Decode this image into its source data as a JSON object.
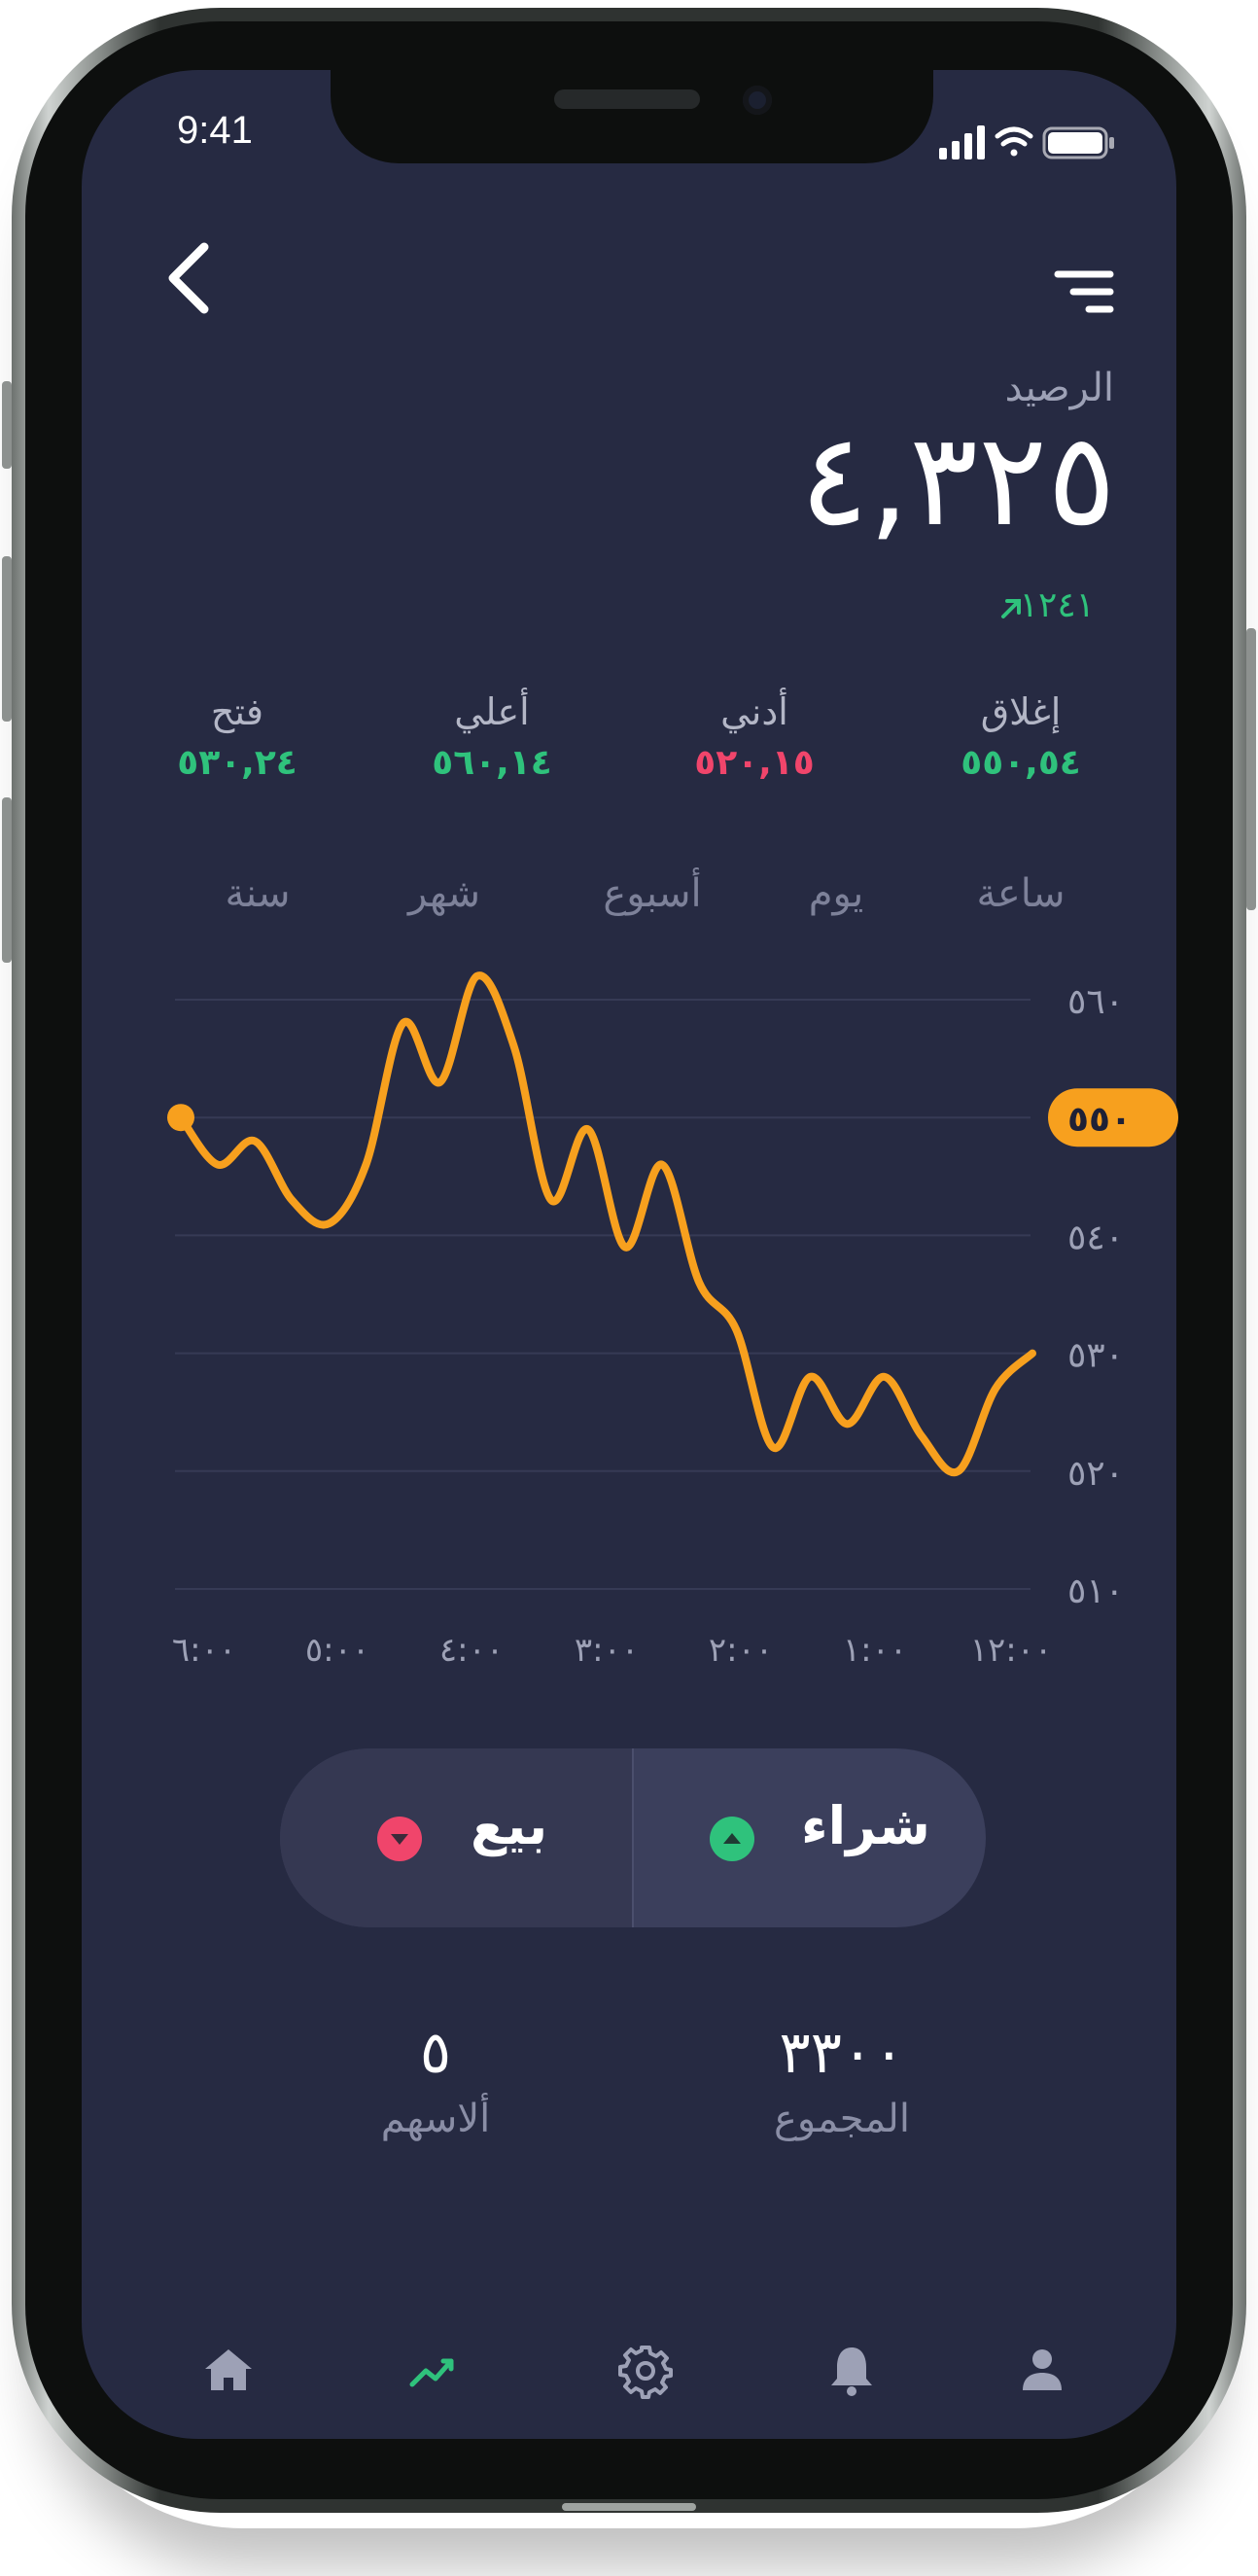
{
  "status": {
    "time": "9:41"
  },
  "header": {
    "back_icon": "chevron-left-icon",
    "menu_icon": "sort-menu-icon"
  },
  "balance": {
    "label": "الرصيد",
    "value": "٤,٣٢٥",
    "change": "١٢٤١",
    "change_icon": "arrow-up-right-icon",
    "change_color": "#2fc27c"
  },
  "stats": [
    {
      "label": "فتح",
      "value": "٥٣٠,٢٤",
      "color": "#2fc27c"
    },
    {
      "label": "أعلي",
      "value": "٥٦٠,١٤",
      "color": "#2fc27c"
    },
    {
      "label": "أدني",
      "value": "٥٢٠,١٥",
      "color": "#f0456b"
    },
    {
      "label": "إغلاق",
      "value": "٥٥٠,٥٤",
      "color": "#2fc27c"
    }
  ],
  "tabs": [
    {
      "label": "سنة"
    },
    {
      "label": "شهر"
    },
    {
      "label": "أسبوع"
    },
    {
      "label": "يوم"
    },
    {
      "label": "ساعة",
      "active": true
    }
  ],
  "chart_data": {
    "type": "line",
    "series": [
      {
        "color": "#f7a01e",
        "values": [
          550,
          546,
          548,
          543,
          541,
          546,
          558,
          553,
          562,
          556,
          543,
          549,
          539,
          546,
          536,
          532,
          522,
          528,
          524,
          528,
          523,
          520,
          527,
          530
        ]
      }
    ],
    "x_tick_labels": [
      "٦:٠٠",
      "٥:٠٠",
      "٤:٠٠",
      "٣:٠٠",
      "٢:٠٠",
      "١:٠٠",
      "١٢:٠٠"
    ],
    "y_tick_labels": [
      "٥٦٠",
      "٥٥٠",
      "٥٤٠",
      "٥٣٠",
      "٥٢٠",
      "٥١٠"
    ],
    "y_ticks": [
      560,
      550,
      540,
      530,
      520,
      510
    ],
    "ylim": [
      510,
      560
    ],
    "highlight": {
      "value": 550,
      "label": "٥٥٠",
      "color": "#f7a01e"
    },
    "grid": true
  },
  "trade": {
    "buy_label": "شراء",
    "sell_label": "بيع",
    "buy_color": "#2fc27c",
    "sell_color": "#f0456b",
    "buy_icon": "triangle-up-icon",
    "sell_icon": "triangle-down-icon"
  },
  "totals": {
    "total_label": "المجموع",
    "total_value": "٣٣٠٠",
    "shares_label": "ألاسهم",
    "shares_value": "٥"
  },
  "nav": [
    {
      "icon": "home-icon",
      "active": false
    },
    {
      "icon": "chart-icon",
      "active": true
    },
    {
      "icon": "gear-icon",
      "active": false
    },
    {
      "icon": "bell-icon",
      "active": false
    },
    {
      "icon": "user-icon",
      "active": false
    }
  ],
  "colors": {
    "screen_bg": "#262a42",
    "accent": "#f7a01e",
    "positive": "#2fc27c",
    "negative": "#f0456b"
  }
}
